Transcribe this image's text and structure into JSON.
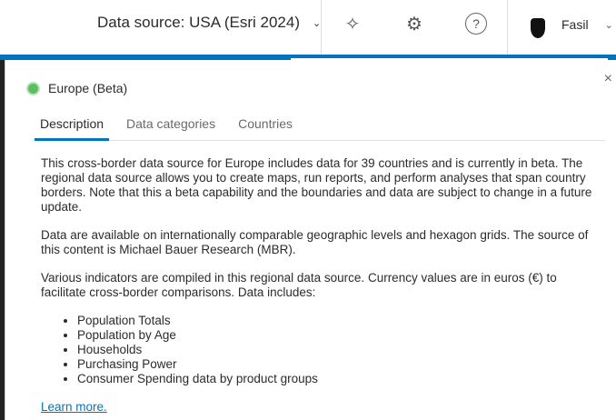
{
  "header": {
    "data_source": "Data source: USA (Esri 2024)",
    "user_name": "Fasil",
    "icons": [
      "sparkle-icon",
      "gear-icon",
      "help-icon"
    ]
  },
  "panel": {
    "title": "Europe (Beta)",
    "close": "×",
    "tabs": [
      {
        "label": "Description"
      },
      {
        "label": "Data categories"
      },
      {
        "label": "Countries"
      }
    ],
    "paragraphs": [
      "This cross-border data source for Europe includes data for 39 countries and is currently in beta. The regional data source allows you to create maps, run reports, and perform analyses that span country borders. Note that this a beta capability and the boundaries and data are subject to change in a future update.",
      "Data are available on internationally comparable geographic levels and hexagon grids. The source of this content is Michael Bauer Research (MBR).",
      "Various indicators are compiled in this regional data source. Currency values are in euros (€) to facilitate cross-border comparisons. Data includes:"
    ],
    "list": [
      "Population Totals",
      "Population by Age",
      "Households",
      "Purchasing Power",
      "Consumer Spending data by product groups"
    ],
    "learn_more": "Learn more."
  }
}
